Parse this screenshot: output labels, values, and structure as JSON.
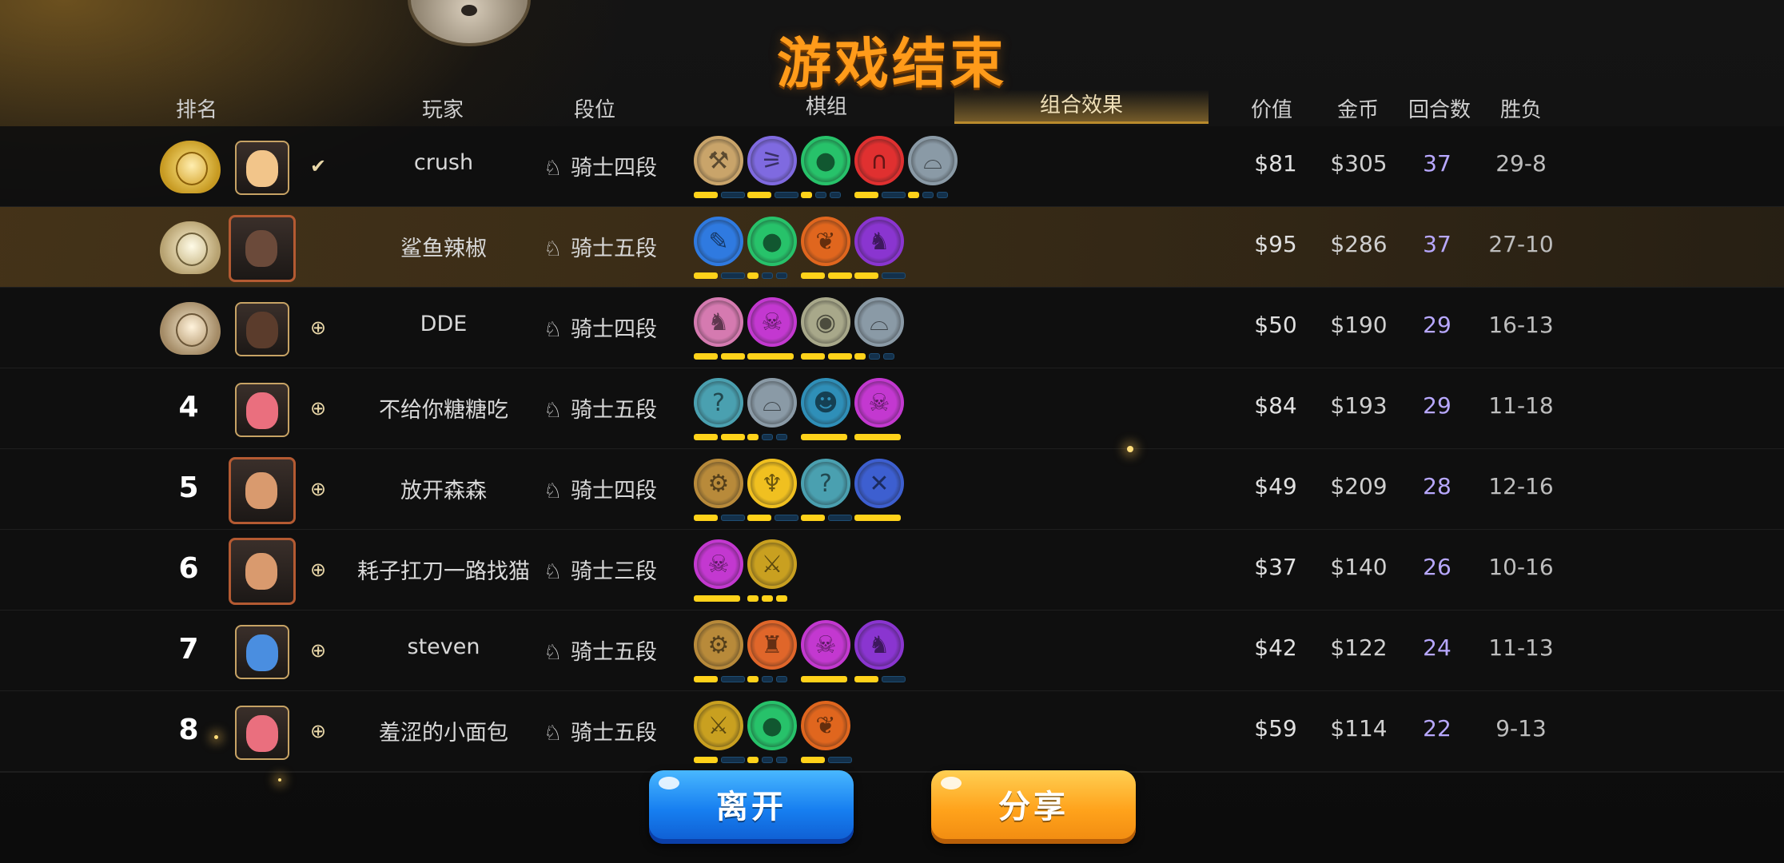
{
  "title": "游戏结束",
  "headers": {
    "rank": "排名",
    "player": "玩家",
    "tier": "段位",
    "pieces": "棋组",
    "combo": "组合效果",
    "value": "价值",
    "gold": "金币",
    "rounds": "回合数",
    "winloss": "胜负"
  },
  "colors": {
    "accent_orange": "#ff9b1a",
    "bar_on": "#ffd21a",
    "bar_off": "#13304a",
    "rounds_text": "#b8a8ff",
    "leave_button": "#167ef0",
    "share_button": "#ffa21b"
  },
  "players": [
    {
      "rank": "1",
      "medal": "gold",
      "avatar": "elf-girl-avatar",
      "avatar_color": "#f2c58a",
      "frame": false,
      "status_icon": "ready-check-icon",
      "status_glyph": "✔",
      "name": "crush",
      "tier": "骑士四段",
      "synergies": [
        {
          "icon": "axe-icon",
          "glyph": "⚒",
          "color": "#c9a46a"
        },
        {
          "icon": "fish-bone-icon",
          "glyph": "⚞",
          "color": "#7f6ae0"
        },
        {
          "icon": "paw-icon",
          "glyph": "●",
          "color": "#27c26a"
        },
        {
          "icon": "arc-icon",
          "glyph": "∩",
          "color": "#e03030"
        },
        {
          "icon": "helmet-icon",
          "glyph": "⌓",
          "color": "#8a9aa6"
        }
      ],
      "bars": [
        [
          1,
          0
        ],
        [
          1,
          0
        ],
        [
          1,
          0,
          0
        ],
        [
          1,
          0
        ],
        [
          1,
          0,
          0
        ]
      ],
      "value": "$81",
      "gold": "$305",
      "rounds": "37",
      "wl": "29-8"
    },
    {
      "rank": "2",
      "medal": "silver",
      "avatar": "boar-warrior-avatar",
      "avatar_color": "#6b4a3a",
      "frame": true,
      "status_icon": "",
      "status_glyph": "",
      "name": "鲨鱼辣椒",
      "tier": "骑士五段",
      "synergies": [
        {
          "icon": "feather-icon",
          "glyph": "✎",
          "color": "#2f7ae0"
        },
        {
          "icon": "paw-icon",
          "glyph": "●",
          "color": "#27c26a"
        },
        {
          "icon": "leaf-icon",
          "glyph": "❦",
          "color": "#e0661e"
        },
        {
          "icon": "demon-icon",
          "glyph": "♞",
          "color": "#8a35d0"
        }
      ],
      "bars": [
        [
          1,
          0
        ],
        [
          1,
          0,
          0
        ],
        [
          1,
          1
        ],
        [
          1,
          0
        ]
      ],
      "value": "$95",
      "gold": "$286",
      "rounds": "37",
      "wl": "27-10"
    },
    {
      "rank": "3",
      "medal": "bronze",
      "avatar": "dwarf-avatar",
      "avatar_color": "#5b3c2c",
      "frame": false,
      "status_icon": "add-friend-icon",
      "status_glyph": "⊕",
      "name": "DDE",
      "tier": "骑士四段",
      "synergies": [
        {
          "icon": "knight-piece-icon",
          "glyph": "♞",
          "color": "#d57ab0"
        },
        {
          "icon": "skull-icon",
          "glyph": "☠",
          "color": "#c338d0"
        },
        {
          "icon": "owl-icon",
          "glyph": "◉",
          "color": "#a8a88a"
        },
        {
          "icon": "helmet-icon",
          "glyph": "⌓",
          "color": "#8a9aa6"
        }
      ],
      "bars": [
        [
          1,
          1
        ],
        [
          1
        ],
        [
          1,
          1
        ],
        [
          1,
          0,
          0
        ]
      ],
      "value": "$50",
      "gold": "$190",
      "rounds": "29",
      "wl": "16-13"
    },
    {
      "rank": "4",
      "medal": "",
      "avatar": "pink-ogre-avatar",
      "avatar_color": "#ea6f7e",
      "frame": false,
      "status_icon": "add-friend-icon",
      "status_glyph": "⊕",
      "name": "不给你糖糖吃",
      "tier": "骑士五段",
      "synergies": [
        {
          "icon": "staff-icon",
          "glyph": "?",
          "color": "#4aa0b0"
        },
        {
          "icon": "helmet-icon",
          "glyph": "⌓",
          "color": "#8a9aa6"
        },
        {
          "icon": "pumpkin-icon",
          "glyph": "☻",
          "color": "#2f8fb8"
        },
        {
          "icon": "skull-icon",
          "glyph": "☠",
          "color": "#c338d0"
        }
      ],
      "bars": [
        [
          1,
          1
        ],
        [
          1,
          0,
          0
        ],
        [
          1
        ],
        [
          1
        ]
      ],
      "value": "$84",
      "gold": "$193",
      "rounds": "29",
      "wl": "11-18"
    },
    {
      "rank": "5",
      "medal": "",
      "avatar": "elf-warrior-avatar",
      "avatar_color": "#d99a6e",
      "frame": true,
      "status_icon": "add-friend-icon",
      "status_glyph": "⊕",
      "name": "放开森森",
      "tier": "骑士四段",
      "synergies": [
        {
          "icon": "gear-icon",
          "glyph": "⚙",
          "color": "#b88a3a"
        },
        {
          "icon": "god-icon",
          "glyph": "♆",
          "color": "#f0c020"
        },
        {
          "icon": "staff-icon",
          "glyph": "?",
          "color": "#4aa0b0"
        },
        {
          "icon": "crossed-blades-icon",
          "glyph": "✕",
          "color": "#3d5fd0"
        }
      ],
      "bars": [
        [
          1,
          0
        ],
        [
          1,
          0
        ],
        [
          1,
          0
        ],
        [
          1
        ]
      ],
      "value": "$49",
      "gold": "$209",
      "rounds": "28",
      "wl": "12-16"
    },
    {
      "rank": "6",
      "medal": "",
      "avatar": "elf-warrior-avatar",
      "avatar_color": "#d99a6e",
      "frame": true,
      "status_icon": "add-friend-icon",
      "status_glyph": "⊕",
      "name": "耗子扛刀一路找猫",
      "tier": "骑士三段",
      "synergies": [
        {
          "icon": "skull-icon",
          "glyph": "☠",
          "color": "#c338d0"
        },
        {
          "icon": "daggers-icon",
          "glyph": "⚔",
          "color": "#c9a020"
        }
      ],
      "bars": [
        [
          1
        ],
        [
          1,
          1,
          1
        ]
      ],
      "value": "$37",
      "gold": "$140",
      "rounds": "26",
      "wl": "10-16"
    },
    {
      "rank": "7",
      "medal": "",
      "avatar": "blue-bird-avatar",
      "avatar_color": "#4a8ee0",
      "frame": false,
      "status_icon": "add-friend-icon",
      "status_glyph": "⊕",
      "name": "steven",
      "tier": "骑士五段",
      "synergies": [
        {
          "icon": "gear-icon",
          "glyph": "⚙",
          "color": "#b88a3a"
        },
        {
          "icon": "ogre-icon",
          "glyph": "♜",
          "color": "#e0662a"
        },
        {
          "icon": "skull-icon",
          "glyph": "☠",
          "color": "#c338d0"
        },
        {
          "icon": "demon-icon",
          "glyph": "♞",
          "color": "#8a35d0"
        }
      ],
      "bars": [
        [
          1,
          0
        ],
        [
          1,
          0,
          0
        ],
        [
          1
        ],
        [
          1,
          0
        ]
      ],
      "value": "$42",
      "gold": "$122",
      "rounds": "24",
      "wl": "11-13"
    },
    {
      "rank": "8",
      "medal": "",
      "avatar": "pink-ogre-avatar",
      "avatar_color": "#ea6f7e",
      "frame": false,
      "status_icon": "add-friend-icon",
      "status_glyph": "⊕",
      "name": "羞涩的小面包",
      "tier": "骑士五段",
      "synergies": [
        {
          "icon": "daggers-icon",
          "glyph": "⚔",
          "color": "#c9a020"
        },
        {
          "icon": "paw-icon",
          "glyph": "●",
          "color": "#27c26a"
        },
        {
          "icon": "leaf-icon",
          "glyph": "❦",
          "color": "#e0661e"
        }
      ],
      "bars": [
        [
          1,
          0
        ],
        [
          1,
          0,
          0
        ],
        [
          1,
          0
        ]
      ],
      "value": "$59",
      "gold": "$114",
      "rounds": "22",
      "wl": "9-13"
    }
  ],
  "buttons": {
    "leave": "离开",
    "share": "分享"
  }
}
